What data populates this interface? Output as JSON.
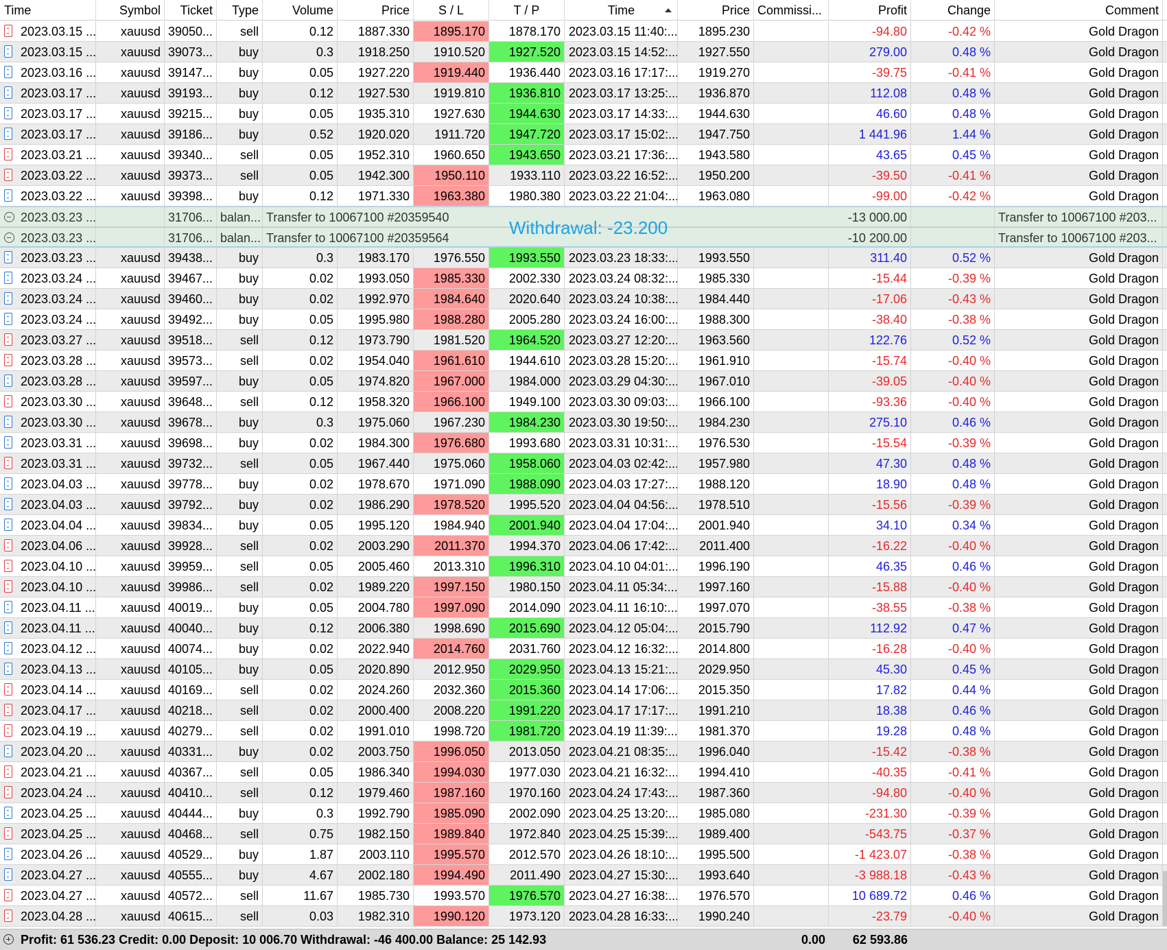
{
  "columns": {
    "time": "Time",
    "symbol": "Symbol",
    "ticket": "Ticket",
    "type": "Type",
    "volume": "Volume",
    "price": "Price",
    "sl": "S / L",
    "tp": "T / P",
    "close_time": "Time",
    "close_price": "Price",
    "commission": "Commissi...",
    "profit": "Profit",
    "change": "Change",
    "comment": "Comment"
  },
  "rows": [
    {
      "kind": "trade",
      "time": "2023.03.15 ...",
      "symbol": "xauusd",
      "ticket": "39050...",
      "type": "sell",
      "volume": "0.12",
      "price": "1887.330",
      "sl": "1895.170",
      "tp": "1878.170",
      "close_time": "2023.03.15 11:40:...",
      "close_price": "1895.230",
      "profit": "-94.80",
      "change": "-0.42 %",
      "comment": "Gold Dragon",
      "hit": "sl"
    },
    {
      "kind": "trade",
      "time": "2023.03.15 ...",
      "symbol": "xauusd",
      "ticket": "39073...",
      "type": "buy",
      "volume": "0.3",
      "price": "1918.250",
      "sl": "1910.520",
      "tp": "1927.520",
      "close_time": "2023.03.15 14:52:...",
      "close_price": "1927.550",
      "profit": "279.00",
      "change": "0.48 %",
      "comment": "Gold Dragon",
      "hit": "tp"
    },
    {
      "kind": "trade",
      "time": "2023.03.16 ...",
      "symbol": "xauusd",
      "ticket": "39147...",
      "type": "buy",
      "volume": "0.05",
      "price": "1927.220",
      "sl": "1919.440",
      "tp": "1936.440",
      "close_time": "2023.03.16 17:17:...",
      "close_price": "1919.270",
      "profit": "-39.75",
      "change": "-0.41 %",
      "comment": "Gold Dragon",
      "hit": "sl"
    },
    {
      "kind": "trade",
      "time": "2023.03.17 ...",
      "symbol": "xauusd",
      "ticket": "39193...",
      "type": "buy",
      "volume": "0.12",
      "price": "1927.530",
      "sl": "1919.810",
      "tp": "1936.810",
      "close_time": "2023.03.17 13:25:...",
      "close_price": "1936.870",
      "profit": "112.08",
      "change": "0.48 %",
      "comment": "Gold Dragon",
      "hit": "tp"
    },
    {
      "kind": "trade",
      "time": "2023.03.17 ...",
      "symbol": "xauusd",
      "ticket": "39215...",
      "type": "buy",
      "volume": "0.05",
      "price": "1935.310",
      "sl": "1927.630",
      "tp": "1944.630",
      "close_time": "2023.03.17 14:33:...",
      "close_price": "1944.630",
      "profit": "46.60",
      "change": "0.48 %",
      "comment": "Gold Dragon",
      "hit": "tp"
    },
    {
      "kind": "trade",
      "time": "2023.03.17 ...",
      "symbol": "xauusd",
      "ticket": "39186...",
      "type": "buy",
      "volume": "0.52",
      "price": "1920.020",
      "sl": "1911.720",
      "tp": "1947.720",
      "close_time": "2023.03.17 15:02:...",
      "close_price": "1947.750",
      "profit": "1 441.96",
      "change": "1.44 %",
      "comment": "Gold Dragon",
      "hit": "tp"
    },
    {
      "kind": "trade",
      "time": "2023.03.21 ...",
      "symbol": "xauusd",
      "ticket": "39340...",
      "type": "sell",
      "volume": "0.05",
      "price": "1952.310",
      "sl": "1960.650",
      "tp": "1943.650",
      "close_time": "2023.03.21 17:36:...",
      "close_price": "1943.580",
      "profit": "43.65",
      "change": "0.45 %",
      "comment": "Gold Dragon",
      "hit": "tp"
    },
    {
      "kind": "trade",
      "time": "2023.03.22 ...",
      "symbol": "xauusd",
      "ticket": "39373...",
      "type": "sell",
      "volume": "0.05",
      "price": "1942.300",
      "sl": "1950.110",
      "tp": "1933.110",
      "close_time": "2023.03.22 16:52:...",
      "close_price": "1950.200",
      "profit": "-39.50",
      "change": "-0.41 %",
      "comment": "Gold Dragon",
      "hit": "sl"
    },
    {
      "kind": "trade",
      "time": "2023.03.22 ...",
      "symbol": "xauusd",
      "ticket": "39398...",
      "type": "buy",
      "volume": "0.12",
      "price": "1971.330",
      "sl": "1963.380",
      "tp": "1980.380",
      "close_time": "2023.03.22 21:04:...",
      "close_price": "1963.080",
      "profit": "-99.00",
      "change": "-0.42 %",
      "comment": "Gold Dragon",
      "hit": "sl"
    },
    {
      "kind": "balance",
      "time": "2023.03.23 ...",
      "ticket": "31706...",
      "type": "balan...",
      "description": "Transfer to 10067100 #20359540",
      "profit": "-13 000.00",
      "comment": "Transfer to 10067100 #203..."
    },
    {
      "kind": "balance",
      "time": "2023.03.23 ...",
      "ticket": "31706...",
      "type": "balan...",
      "description": "Transfer to 10067100 #20359564",
      "profit": "-10 200.00",
      "comment": "Transfer to 10067100 #203..."
    },
    {
      "kind": "trade",
      "time": "2023.03.23 ...",
      "symbol": "xauusd",
      "ticket": "39438...",
      "type": "buy",
      "volume": "0.3",
      "price": "1983.170",
      "sl": "1976.550",
      "tp": "1993.550",
      "close_time": "2023.03.23 18:33:...",
      "close_price": "1993.550",
      "profit": "311.40",
      "change": "0.52 %",
      "comment": "Gold Dragon",
      "hit": "tp"
    },
    {
      "kind": "trade",
      "time": "2023.03.24 ...",
      "symbol": "xauusd",
      "ticket": "39467...",
      "type": "buy",
      "volume": "0.02",
      "price": "1993.050",
      "sl": "1985.330",
      "tp": "2002.330",
      "close_time": "2023.03.24 08:32:...",
      "close_price": "1985.330",
      "profit": "-15.44",
      "change": "-0.39 %",
      "comment": "Gold Dragon",
      "hit": "sl"
    },
    {
      "kind": "trade",
      "time": "2023.03.24 ...",
      "symbol": "xauusd",
      "ticket": "39460...",
      "type": "buy",
      "volume": "0.02",
      "price": "1992.970",
      "sl": "1984.640",
      "tp": "2020.640",
      "close_time": "2023.03.24 10:38:...",
      "close_price": "1984.440",
      "profit": "-17.06",
      "change": "-0.43 %",
      "comment": "Gold Dragon",
      "hit": "sl"
    },
    {
      "kind": "trade",
      "time": "2023.03.24 ...",
      "symbol": "xauusd",
      "ticket": "39492...",
      "type": "buy",
      "volume": "0.05",
      "price": "1995.980",
      "sl": "1988.280",
      "tp": "2005.280",
      "close_time": "2023.03.24 16:00:...",
      "close_price": "1988.300",
      "profit": "-38.40",
      "change": "-0.38 %",
      "comment": "Gold Dragon",
      "hit": "sl"
    },
    {
      "kind": "trade",
      "time": "2023.03.27 ...",
      "symbol": "xauusd",
      "ticket": "39518...",
      "type": "sell",
      "volume": "0.12",
      "price": "1973.790",
      "sl": "1981.520",
      "tp": "1964.520",
      "close_time": "2023.03.27 12:20:...",
      "close_price": "1963.560",
      "profit": "122.76",
      "change": "0.52 %",
      "comment": "Gold Dragon",
      "hit": "tp"
    },
    {
      "kind": "trade",
      "time": "2023.03.28 ...",
      "symbol": "xauusd",
      "ticket": "39573...",
      "type": "sell",
      "volume": "0.02",
      "price": "1954.040",
      "sl": "1961.610",
      "tp": "1944.610",
      "close_time": "2023.03.28 15:20:...",
      "close_price": "1961.910",
      "profit": "-15.74",
      "change": "-0.40 %",
      "comment": "Gold Dragon",
      "hit": "sl"
    },
    {
      "kind": "trade",
      "time": "2023.03.28 ...",
      "symbol": "xauusd",
      "ticket": "39597...",
      "type": "buy",
      "volume": "0.05",
      "price": "1974.820",
      "sl": "1967.000",
      "tp": "1984.000",
      "close_time": "2023.03.29 04:30:...",
      "close_price": "1967.010",
      "profit": "-39.05",
      "change": "-0.40 %",
      "comment": "Gold Dragon",
      "hit": "sl"
    },
    {
      "kind": "trade",
      "time": "2023.03.30 ...",
      "symbol": "xauusd",
      "ticket": "39648...",
      "type": "sell",
      "volume": "0.12",
      "price": "1958.320",
      "sl": "1966.100",
      "tp": "1949.100",
      "close_time": "2023.03.30 09:03:...",
      "close_price": "1966.100",
      "profit": "-93.36",
      "change": "-0.40 %",
      "comment": "Gold Dragon",
      "hit": "sl"
    },
    {
      "kind": "trade",
      "time": "2023.03.30 ...",
      "symbol": "xauusd",
      "ticket": "39678...",
      "type": "buy",
      "volume": "0.3",
      "price": "1975.060",
      "sl": "1967.230",
      "tp": "1984.230",
      "close_time": "2023.03.30 19:50:...",
      "close_price": "1984.230",
      "profit": "275.10",
      "change": "0.46 %",
      "comment": "Gold Dragon",
      "hit": "tp"
    },
    {
      "kind": "trade",
      "time": "2023.03.31 ...",
      "symbol": "xauusd",
      "ticket": "39698...",
      "type": "buy",
      "volume": "0.02",
      "price": "1984.300",
      "sl": "1976.680",
      "tp": "1993.680",
      "close_time": "2023.03.31 10:31:...",
      "close_price": "1976.530",
      "profit": "-15.54",
      "change": "-0.39 %",
      "comment": "Gold Dragon",
      "hit": "sl"
    },
    {
      "kind": "trade",
      "time": "2023.03.31 ...",
      "symbol": "xauusd",
      "ticket": "39732...",
      "type": "sell",
      "volume": "0.05",
      "price": "1967.440",
      "sl": "1975.060",
      "tp": "1958.060",
      "close_time": "2023.04.03 02:42:...",
      "close_price": "1957.980",
      "profit": "47.30",
      "change": "0.48 %",
      "comment": "Gold Dragon",
      "hit": "tp"
    },
    {
      "kind": "trade",
      "time": "2023.04.03 ...",
      "symbol": "xauusd",
      "ticket": "39778...",
      "type": "buy",
      "volume": "0.02",
      "price": "1978.670",
      "sl": "1971.090",
      "tp": "1988.090",
      "close_time": "2023.04.03 17:27:...",
      "close_price": "1988.120",
      "profit": "18.90",
      "change": "0.48 %",
      "comment": "Gold Dragon",
      "hit": "tp"
    },
    {
      "kind": "trade",
      "time": "2023.04.03 ...",
      "symbol": "xauusd",
      "ticket": "39792...",
      "type": "buy",
      "volume": "0.02",
      "price": "1986.290",
      "sl": "1978.520",
      "tp": "1995.520",
      "close_time": "2023.04.04 04:56:...",
      "close_price": "1978.510",
      "profit": "-15.56",
      "change": "-0.39 %",
      "comment": "Gold Dragon",
      "hit": "sl"
    },
    {
      "kind": "trade",
      "time": "2023.04.04 ...",
      "symbol": "xauusd",
      "ticket": "39834...",
      "type": "buy",
      "volume": "0.05",
      "price": "1995.120",
      "sl": "1984.940",
      "tp": "2001.940",
      "close_time": "2023.04.04 17:04:...",
      "close_price": "2001.940",
      "profit": "34.10",
      "change": "0.34 %",
      "comment": "Gold Dragon",
      "hit": "tp"
    },
    {
      "kind": "trade",
      "time": "2023.04.06 ...",
      "symbol": "xauusd",
      "ticket": "39928...",
      "type": "sell",
      "volume": "0.02",
      "price": "2003.290",
      "sl": "2011.370",
      "tp": "1994.370",
      "close_time": "2023.04.06 17:42:...",
      "close_price": "2011.400",
      "profit": "-16.22",
      "change": "-0.40 %",
      "comment": "Gold Dragon",
      "hit": "sl"
    },
    {
      "kind": "trade",
      "time": "2023.04.10 ...",
      "symbol": "xauusd",
      "ticket": "39959...",
      "type": "sell",
      "volume": "0.05",
      "price": "2005.460",
      "sl": "2013.310",
      "tp": "1996.310",
      "close_time": "2023.04.10 04:01:...",
      "close_price": "1996.190",
      "profit": "46.35",
      "change": "0.46 %",
      "comment": "Gold Dragon",
      "hit": "tp"
    },
    {
      "kind": "trade",
      "time": "2023.04.10 ...",
      "symbol": "xauusd",
      "ticket": "39986...",
      "type": "sell",
      "volume": "0.02",
      "price": "1989.220",
      "sl": "1997.150",
      "tp": "1980.150",
      "close_time": "2023.04.11 05:34:...",
      "close_price": "1997.160",
      "profit": "-15.88",
      "change": "-0.40 %",
      "comment": "Gold Dragon",
      "hit": "sl"
    },
    {
      "kind": "trade",
      "time": "2023.04.11 ...",
      "symbol": "xauusd",
      "ticket": "40019...",
      "type": "buy",
      "volume": "0.05",
      "price": "2004.780",
      "sl": "1997.090",
      "tp": "2014.090",
      "close_time": "2023.04.11 16:10:...",
      "close_price": "1997.070",
      "profit": "-38.55",
      "change": "-0.38 %",
      "comment": "Gold Dragon",
      "hit": "sl"
    },
    {
      "kind": "trade",
      "time": "2023.04.11 ...",
      "symbol": "xauusd",
      "ticket": "40040...",
      "type": "buy",
      "volume": "0.12",
      "price": "2006.380",
      "sl": "1998.690",
      "tp": "2015.690",
      "close_time": "2023.04.12 05:04:...",
      "close_price": "2015.790",
      "profit": "112.92",
      "change": "0.47 %",
      "comment": "Gold Dragon",
      "hit": "tp"
    },
    {
      "kind": "trade",
      "time": "2023.04.12 ...",
      "symbol": "xauusd",
      "ticket": "40074...",
      "type": "buy",
      "volume": "0.02",
      "price": "2022.940",
      "sl": "2014.760",
      "tp": "2031.760",
      "close_time": "2023.04.12 16:32:...",
      "close_price": "2014.800",
      "profit": "-16.28",
      "change": "-0.40 %",
      "comment": "Gold Dragon",
      "hit": "sl"
    },
    {
      "kind": "trade",
      "time": "2023.04.13 ...",
      "symbol": "xauusd",
      "ticket": "40105...",
      "type": "buy",
      "volume": "0.05",
      "price": "2020.890",
      "sl": "2012.950",
      "tp": "2029.950",
      "close_time": "2023.04.13 15:21:...",
      "close_price": "2029.950",
      "profit": "45.30",
      "change": "0.45 %",
      "comment": "Gold Dragon",
      "hit": "tp"
    },
    {
      "kind": "trade",
      "time": "2023.04.14 ...",
      "symbol": "xauusd",
      "ticket": "40169...",
      "type": "sell",
      "volume": "0.02",
      "price": "2024.260",
      "sl": "2032.360",
      "tp": "2015.360",
      "close_time": "2023.04.14 17:06:...",
      "close_price": "2015.350",
      "profit": "17.82",
      "change": "0.44 %",
      "comment": "Gold Dragon",
      "hit": "tp"
    },
    {
      "kind": "trade",
      "time": "2023.04.17 ...",
      "symbol": "xauusd",
      "ticket": "40218...",
      "type": "sell",
      "volume": "0.02",
      "price": "2000.400",
      "sl": "2008.220",
      "tp": "1991.220",
      "close_time": "2023.04.17 17:17:...",
      "close_price": "1991.210",
      "profit": "18.38",
      "change": "0.46 %",
      "comment": "Gold Dragon",
      "hit": "tp"
    },
    {
      "kind": "trade",
      "time": "2023.04.19 ...",
      "symbol": "xauusd",
      "ticket": "40279...",
      "type": "sell",
      "volume": "0.02",
      "price": "1991.010",
      "sl": "1998.720",
      "tp": "1981.720",
      "close_time": "2023.04.19 11:39:...",
      "close_price": "1981.370",
      "profit": "19.28",
      "change": "0.48 %",
      "comment": "Gold Dragon",
      "hit": "tp"
    },
    {
      "kind": "trade",
      "time": "2023.04.20 ...",
      "symbol": "xauusd",
      "ticket": "40331...",
      "type": "buy",
      "volume": "0.02",
      "price": "2003.750",
      "sl": "1996.050",
      "tp": "2013.050",
      "close_time": "2023.04.21 08:35:...",
      "close_price": "1996.040",
      "profit": "-15.42",
      "change": "-0.38 %",
      "comment": "Gold Dragon",
      "hit": "sl"
    },
    {
      "kind": "trade",
      "time": "2023.04.21 ...",
      "symbol": "xauusd",
      "ticket": "40367...",
      "type": "sell",
      "volume": "0.05",
      "price": "1986.340",
      "sl": "1994.030",
      "tp": "1977.030",
      "close_time": "2023.04.21 16:32:...",
      "close_price": "1994.410",
      "profit": "-40.35",
      "change": "-0.41 %",
      "comment": "Gold Dragon",
      "hit": "sl"
    },
    {
      "kind": "trade",
      "time": "2023.04.24 ...",
      "symbol": "xauusd",
      "ticket": "40410...",
      "type": "sell",
      "volume": "0.12",
      "price": "1979.460",
      "sl": "1987.160",
      "tp": "1970.160",
      "close_time": "2023.04.24 17:43:...",
      "close_price": "1987.360",
      "profit": "-94.80",
      "change": "-0.40 %",
      "comment": "Gold Dragon",
      "hit": "sl"
    },
    {
      "kind": "trade",
      "time": "2023.04.25 ...",
      "symbol": "xauusd",
      "ticket": "40444...",
      "type": "buy",
      "volume": "0.3",
      "price": "1992.790",
      "sl": "1985.090",
      "tp": "2002.090",
      "close_time": "2023.04.25 13:20:...",
      "close_price": "1985.080",
      "profit": "-231.30",
      "change": "-0.39 %",
      "comment": "Gold Dragon",
      "hit": "sl"
    },
    {
      "kind": "trade",
      "time": "2023.04.25 ...",
      "symbol": "xauusd",
      "ticket": "40468...",
      "type": "sell",
      "volume": "0.75",
      "price": "1982.150",
      "sl": "1989.840",
      "tp": "1972.840",
      "close_time": "2023.04.25 15:39:...",
      "close_price": "1989.400",
      "profit": "-543.75",
      "change": "-0.37 %",
      "comment": "Gold Dragon",
      "hit": "sl"
    },
    {
      "kind": "trade",
      "time": "2023.04.26 ...",
      "symbol": "xauusd",
      "ticket": "40529...",
      "type": "buy",
      "volume": "1.87",
      "price": "2003.110",
      "sl": "1995.570",
      "tp": "2012.570",
      "close_time": "2023.04.26 18:10:...",
      "close_price": "1995.500",
      "profit": "-1 423.07",
      "change": "-0.38 %",
      "comment": "Gold Dragon",
      "hit": "sl"
    },
    {
      "kind": "trade",
      "time": "2023.04.27 ...",
      "symbol": "xauusd",
      "ticket": "40555...",
      "type": "buy",
      "volume": "4.67",
      "price": "2002.180",
      "sl": "1994.490",
      "tp": "2011.490",
      "close_time": "2023.04.27 15:30:...",
      "close_price": "1993.640",
      "profit": "-3 988.18",
      "change": "-0.43 %",
      "comment": "Gold Dragon",
      "hit": "sl"
    },
    {
      "kind": "trade",
      "time": "2023.04.27 ...",
      "symbol": "xauusd",
      "ticket": "40572...",
      "type": "sell",
      "volume": "11.67",
      "price": "1985.730",
      "sl": "1993.570",
      "tp": "1976.570",
      "close_time": "2023.04.27 16:38:...",
      "close_price": "1976.570",
      "profit": "10 689.72",
      "change": "0.46 %",
      "comment": "Gold Dragon",
      "hit": "tp"
    },
    {
      "kind": "trade",
      "time": "2023.04.28 ...",
      "symbol": "xauusd",
      "ticket": "40615...",
      "type": "sell",
      "volume": "0.03",
      "price": "1982.310",
      "sl": "1990.120",
      "tp": "1973.120",
      "close_time": "2023.04.28 16:33:...",
      "close_price": "1990.240",
      "profit": "-23.79",
      "change": "-0.40 %",
      "comment": "Gold Dragon",
      "hit": "sl"
    }
  ],
  "tooltip": "Withdrawal: -23.200",
  "footer": {
    "summary": "Profit: 61 536.23  Credit: 0.00  Deposit: 10 006.70  Withdrawal: -46 400.00  Balance: 25 142.93",
    "commission": "0.00",
    "profit": "62 593.86"
  },
  "colors": {
    "sl_highlight": "#fe9a9a",
    "tp_highlight": "#5ff35f",
    "negative_text": "#e8282b",
    "positive_text": "#2020e0",
    "balance_row": "#e0ede2",
    "tooltip_text": "#1da3e6"
  },
  "icons": {
    "sell_row": "sell-order-icon",
    "buy_row": "buy-order-icon",
    "balance_row": "balance-collapse-icon",
    "footer": "expand-plus-icon"
  }
}
